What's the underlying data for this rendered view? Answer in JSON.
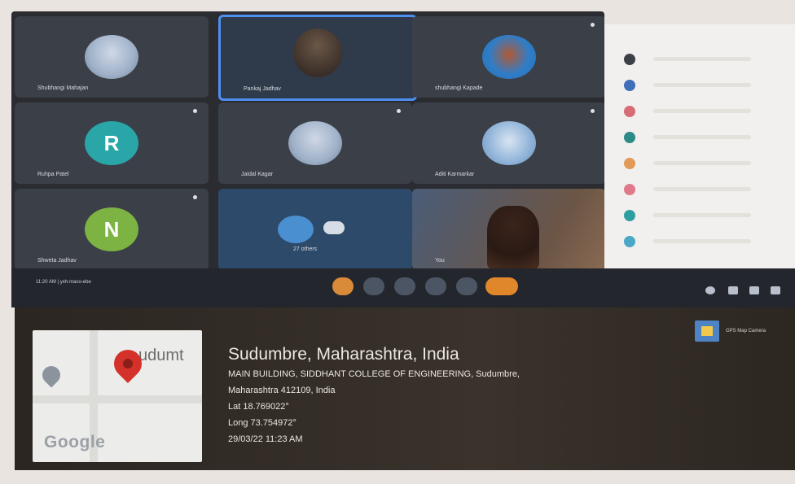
{
  "meeting": {
    "participants": [
      {
        "name": "Shubhangi Mahajan",
        "avatar": "photo"
      },
      {
        "name": "Pankaj Jadhav",
        "avatar": "video"
      },
      {
        "name": "shubhangi Kapade",
        "avatar": "photo"
      },
      {
        "name": "Ruhpa Patel",
        "avatar": "letter",
        "letter": "R",
        "color": "#2aa6a8"
      },
      {
        "name": "Jaidal Kagar",
        "avatar": "photo"
      },
      {
        "name": "Aditi Karmarkar",
        "avatar": "photo"
      },
      {
        "name": "Shweta Jadhav",
        "avatar": "letter",
        "letter": "N",
        "color": "#7cb342"
      },
      {
        "name": "27 others",
        "avatar": "group"
      },
      {
        "name": "You",
        "avatar": "video"
      }
    ],
    "footer_left": "11:20 AM | yxh-maco-ebe"
  },
  "location": {
    "place": "Sudumbre, Maharashtra, India",
    "address_line1": "MAIN BUILDING, SIDDHANT COLLEGE OF ENGINEERING, Sudumbre,",
    "address_line2": "Maharashtra 412109, India",
    "lat": "Lat 18.769022°",
    "long": "Long 73.754972°",
    "datetime": "29/03/22 11:23 AM",
    "map_label": "udumt",
    "map_logo": "Google",
    "badge": "GPS Map Camera"
  },
  "colors": {
    "active_speaker": "#4f8ff0",
    "pin": "#d4312a",
    "end_call": "#e0872b"
  }
}
